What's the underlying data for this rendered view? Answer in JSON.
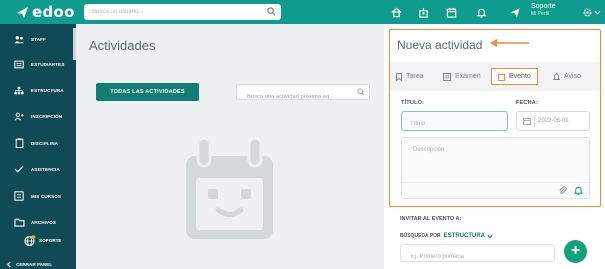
{
  "app": {
    "brand": "edoo"
  },
  "header": {
    "search_placeholder": "Busca un usuario...",
    "icons": [
      "home-icon",
      "school-icon",
      "calendar-icon",
      "bell-icon",
      "send-icon"
    ],
    "user_name": "Soporte",
    "user_sub": "Mi Perfil"
  },
  "sidebar": {
    "items": [
      {
        "label": "STAFF",
        "icon": "staff-icon"
      },
      {
        "label": "ESTUDIANTES",
        "icon": "students-icon"
      },
      {
        "label": "ESTRUCTURA",
        "icon": "structure-icon"
      },
      {
        "label": "INSCRIPCIÓN",
        "icon": "enroll-icon"
      },
      {
        "label": "DISCIPLINA",
        "icon": "discipline-icon"
      },
      {
        "label": "ASISTENCIA",
        "icon": "check-icon"
      },
      {
        "label": "MIS CURSOS",
        "icon": "courses-icon"
      },
      {
        "label": "ARCHIVOS",
        "icon": "folder-icon"
      }
    ],
    "soporte_label": "SOPORTE",
    "collapse_label": "CERRAR PANEL"
  },
  "main": {
    "title": "Actividades",
    "all_button": "TODAS LAS ACTIVIDADES",
    "search_placeholder": "Busca una actividad próxima aq"
  },
  "panel": {
    "title": "Nueva actividad",
    "tabs": [
      {
        "label": "Tarea",
        "icon": "bookmark-icon"
      },
      {
        "label": "Examen",
        "icon": "exam-icon"
      },
      {
        "label": "Evento",
        "icon": "event-icon",
        "active": true
      },
      {
        "label": "Aviso",
        "icon": "bell-icon"
      }
    ],
    "title_label": "TÍTULO:",
    "title_placeholder": "Título",
    "date_label": "FECHA:",
    "date_value": "2022-06-01",
    "description_placeholder": "Descripción",
    "invite_label": "INVITAR AL EVENTO A:",
    "search_by_label": "BÚSQUEDA POR",
    "search_by_value": "ESTRUCTURA",
    "group_placeholder": "Ej. Primero primaria",
    "fab_label": "+"
  },
  "colors": {
    "topbar": "#0f9b8e",
    "sidebar": "#0f4a56",
    "accent": "#117d73",
    "highlight": "#f08a3c",
    "fab": "#12a27a"
  }
}
